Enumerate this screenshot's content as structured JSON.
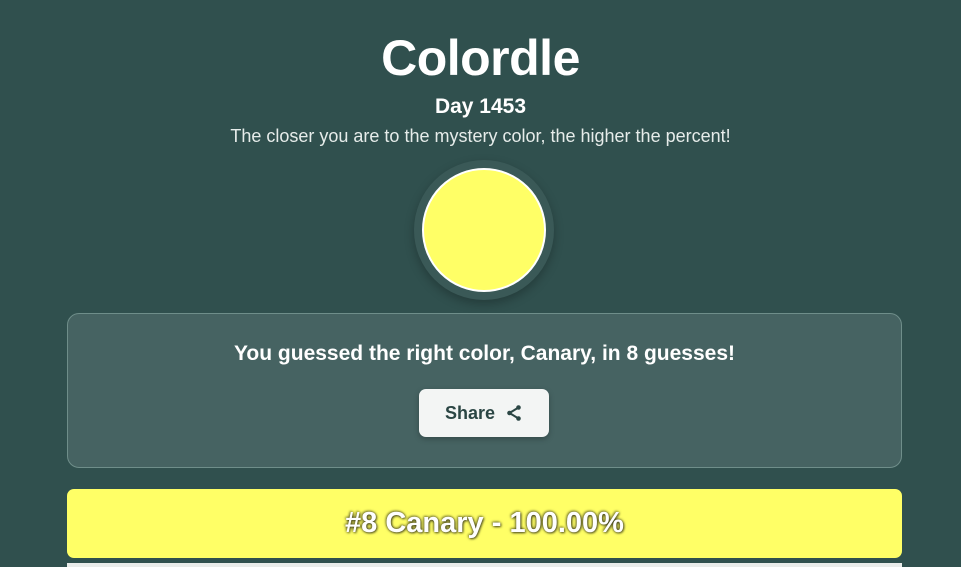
{
  "header": {
    "title": "Colordle",
    "day": "Day 1453",
    "subtitle": "The closer you are to the mystery color, the higher the percent!"
  },
  "mystery_color": {
    "hex": "#ffff66",
    "ring_color": "#3a5957"
  },
  "result": {
    "message": "You guessed the right color, Canary, in 8 guesses!",
    "share_label": "Share",
    "share_icon": "share-icon"
  },
  "guesses": [
    {
      "label": "#8 Canary - 100.00%",
      "color": "#ffff66"
    }
  ],
  "colors": {
    "background": "#30504e",
    "card": "#466362",
    "button": "#f3f5f4",
    "button_text": "#2b4644"
  }
}
